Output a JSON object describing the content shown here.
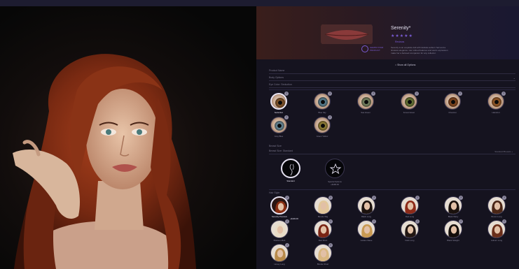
{
  "model": {
    "name": "Serenity*",
    "stars": "★★★★★",
    "reviews_label": "Reviews",
    "description": "Serenity is an exquisite doll with delicate auburn hair and a timeless elegance. Her refined features and warm expression make her a beloved companion for any collector.",
    "brand_lines": [
      "GEMINI STAR",
      "PRODUCT"
    ]
  },
  "options_link": "Show all Options",
  "selects": [
    {
      "label": "Product Name"
    },
    {
      "label": "Body Options"
    },
    {
      "label": "Eye Color: Seduction"
    }
  ],
  "eyes": {
    "items": [
      {
        "name": "Seduction",
        "iris": "#8a5a2c",
        "selected": true
      },
      {
        "name": "Blue Sky",
        "iris": "#5a8aa0",
        "selected": false
      },
      {
        "name": "Sea Green",
        "iris": "#7b8e6a",
        "selected": false
      },
      {
        "name": "Forest Green",
        "iris": "#6a7f3a",
        "selected": false
      },
      {
        "name": "Chestnut",
        "iris": "#8a4a20",
        "selected": false
      },
      {
        "name": "Hazelnut",
        "iris": "#a0602a",
        "selected": false
      },
      {
        "name": "Grey Blue",
        "iris": "#6a94a8",
        "selected": false
      },
      {
        "name": "Green Yellow",
        "iris": "#9a8a3a",
        "selected": false
      }
    ]
  },
  "body": {
    "section_label": "Breast Size",
    "select_label": "Breast Size: Standard",
    "right_note": "Standard Breasts +",
    "items": [
      {
        "name": "Standard",
        "icon": "body-outline-icon",
        "selected": true
      },
      {
        "name": "Special Options",
        "price": "+$199.00",
        "icon": "star-icon",
        "selected": false
      }
    ]
  },
  "hair": {
    "section_label": "Hair Style",
    "items": [
      {
        "name": "Serenity Premium",
        "price": "+$149.00",
        "color": "#8a2e12",
        "selected": true
      },
      {
        "name": "Blonde Wig",
        "color": "#e2c79a",
        "selected": false
      },
      {
        "name": "Black Long",
        "color": "#1c120e",
        "selected": false
      },
      {
        "name": "Red Long",
        "color": "#8c2a18",
        "selected": false
      },
      {
        "name": "Black Wavy",
        "color": "#1a110d",
        "selected": false
      },
      {
        "name": "Brown Long",
        "color": "#4a2616",
        "selected": false
      },
      {
        "name": "Platinum Bob",
        "color": "#e8dcc6",
        "selected": false
      },
      {
        "name": "Red Short",
        "color": "#7a2414",
        "selected": false
      },
      {
        "name": "Golden Wave",
        "color": "#c99a52",
        "selected": false
      },
      {
        "name": "Dark Long",
        "color": "#211612",
        "selected": false
      },
      {
        "name": "Black Straight",
        "color": "#130d0a",
        "selected": false
      },
      {
        "name": "Auburn Long",
        "color": "#6a2e1a",
        "selected": false
      },
      {
        "name": "Honey Long",
        "color": "#b88a4a",
        "selected": false
      },
      {
        "name": "Blonde Short",
        "color": "#d8b680",
        "selected": false
      }
    ]
  }
}
